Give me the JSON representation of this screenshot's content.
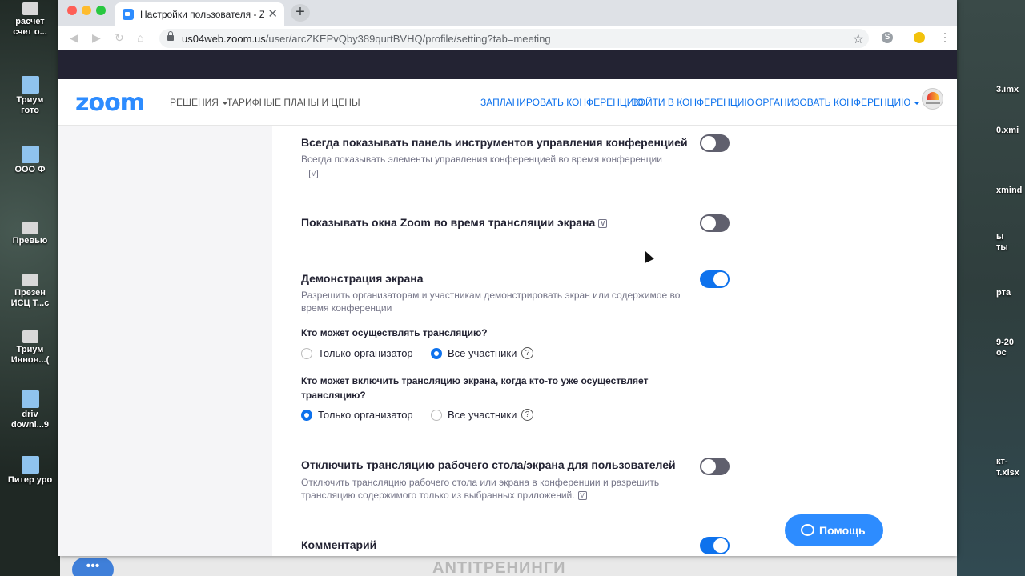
{
  "desktop": {
    "left_icons": [
      {
        "label": "расчет",
        "label2": "счет о..."
      },
      {
        "label": "Триум",
        "label2": "гото"
      },
      {
        "label": "ООО Ф",
        "label2": ""
      },
      {
        "label": "Превью",
        "label2": ""
      },
      {
        "label": "Презен",
        "label2": "ИСЦ Т...с"
      },
      {
        "label": "Триум",
        "label2": "Иннов...("
      },
      {
        "label": "driv",
        "label2": "downl...9"
      },
      {
        "label": "Питер уро",
        "label2": ""
      }
    ],
    "right_labels": [
      "3.imx",
      "0.xmi",
      "xmind",
      "ы",
      "ты",
      "рта",
      "9-20",
      "ос",
      "кт-",
      "т.xlsx"
    ],
    "bottom_text": "ANTITРЕНИНГИ",
    "bubble_glyph": "•••"
  },
  "browser": {
    "tab_title": "Настройки пользователя - Zoom",
    "tab_close": "✕",
    "new_tab": "+",
    "url_host": "us04web.zoom.us",
    "url_path": "/user/arcZKEPvQby389qurtBVHQ/profile/setting?tab=meeting",
    "star": "☆",
    "ext_s": "S",
    "kebab": "⋮"
  },
  "header": {
    "logo": "zoom",
    "solutions": "РЕШЕНИЯ",
    "plans": "ТАРИФНЫЕ ПЛАНЫ И ЦЕНЫ",
    "schedule": "ЗАПЛАНИРОВАТЬ КОНФЕРЕНЦИЮ",
    "join": "ВОЙТИ В КОНФЕРЕНЦИЮ",
    "host": "ОРГАНИЗОВАТЬ КОНФЕРЕНЦИЮ"
  },
  "settings": {
    "toolbar_title": "Всегда показывать панель инструментов управления конференцией",
    "toolbar_desc": "Всегда показывать элементы управления конференцией во время конференции",
    "toolbar_on": false,
    "show_zoom_windows_title": "Показывать окна Zoom во время трансляции экрана",
    "show_zoom_windows_on": false,
    "screen_share_title": "Демонстрация экрана",
    "screen_share_desc": "Разрешить организаторам и участникам демонстрировать экран или содержимое во время конференции",
    "screen_share_on": true,
    "who_can_share_q": "Кто может осуществлять трансляцию?",
    "who_can_start_q": "Кто может включить трансляцию экрана, когда кто-то уже осуществляет трансляцию?",
    "opt_host_only": "Только организатор",
    "opt_all": "Все участники",
    "who_can_share_selected": "Все участники",
    "who_can_start_selected": "Только организатор",
    "disable_desktop_title": "Отключить трансляцию рабочего стола/экрана для пользователей",
    "disable_desktop_desc": "Отключить трансляцию рабочего стола или экрана в конференции и разрешить трансляцию содержимого только из выбранных приложений.",
    "disable_desktop_on": false,
    "annotation_title": "Комментарий",
    "annotation_on": true,
    "v_icon": "V",
    "help_q": "?"
  },
  "help_button": {
    "label": "Помощь"
  },
  "colors": {
    "accent": "#0e72ed",
    "zoom_blue": "#2d8cff",
    "toggle_off": "#5f5f6d"
  }
}
